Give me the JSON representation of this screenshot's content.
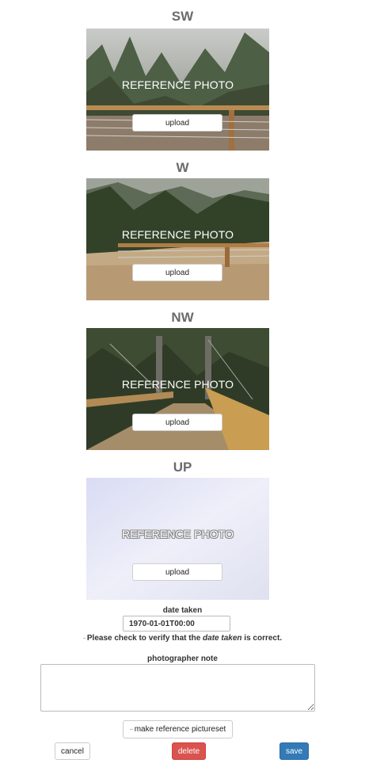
{
  "sections": [
    {
      "heading": "SW",
      "overlay": "REFERENCE PHOTO",
      "upload_label": "upload"
    },
    {
      "heading": "W",
      "overlay": "REFERENCE PHOTO",
      "upload_label": "upload"
    },
    {
      "heading": "NW",
      "overlay": "REFERENCE PHOTO",
      "upload_label": "upload"
    },
    {
      "heading": "UP",
      "overlay": "REFERENCE PHOTO",
      "upload_label": "upload"
    }
  ],
  "date_taken": {
    "label": "date taken",
    "value": "1970-01-01T00:00"
  },
  "verify": {
    "text_before": "Please check to verify that the ",
    "text_emphasis": "date taken",
    "text_after": " is correct."
  },
  "photographer_note": {
    "label": "photographer note",
    "value": ""
  },
  "make_pictureset_label": "make reference pictureset",
  "actions": {
    "cancel": "cancel",
    "delete": "delete",
    "save": "save"
  },
  "colors": {
    "heading": "#6b6b6b",
    "delete": "#d9534f",
    "save": "#337ab7"
  }
}
